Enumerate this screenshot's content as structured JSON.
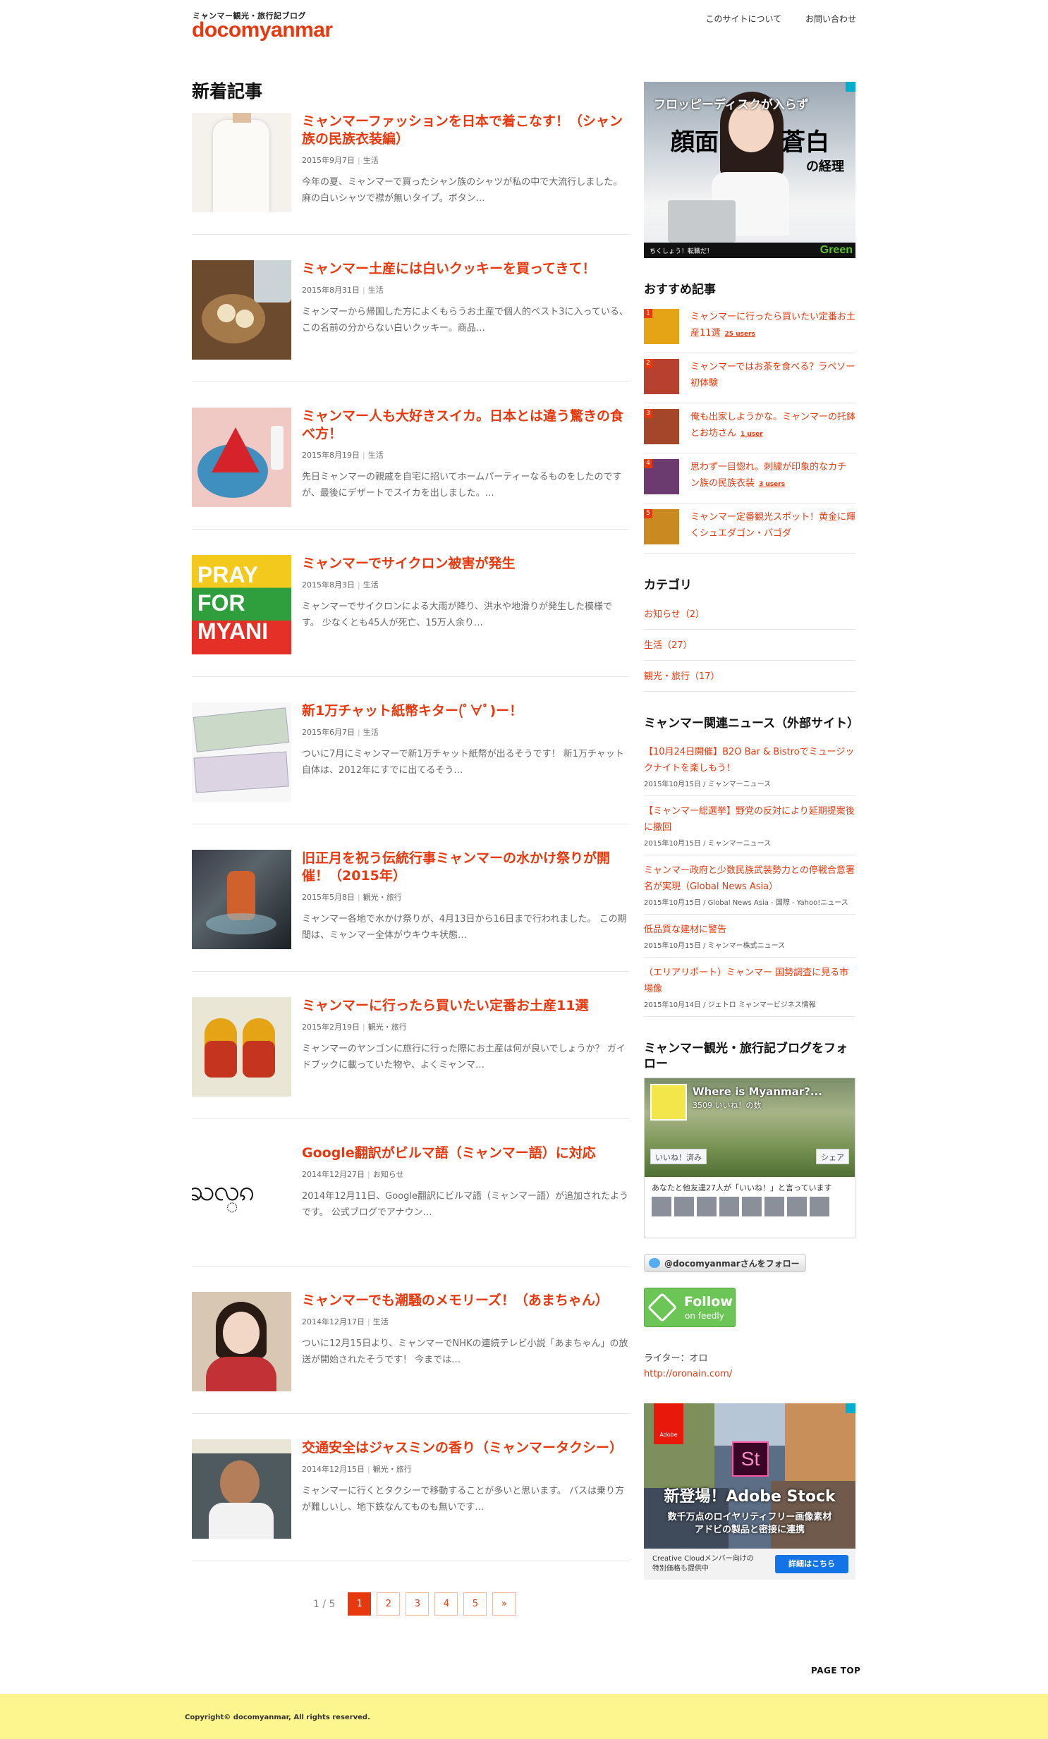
{
  "header": {
    "tagline": "ミャンマー観光・旅行記ブログ",
    "logo": "docomyanmar",
    "nav": [
      "このサイトについて",
      "お問い合わせ"
    ]
  },
  "main": {
    "section_title": "新着記事",
    "entries": [
      {
        "title": "ミャンマーファッションを日本で着こなす！（シャン族の民族衣装編）",
        "date": "2015年9月7日",
        "category": "生活",
        "excerpt": "今年の夏、ミャンマーで買ったシャン族のシャツが私の中で大流行しました。 麻の白いシャツで襟が無いタイプ。ボタン…"
      },
      {
        "title": "ミャンマー土産には白いクッキーを買ってきて！",
        "date": "2015年8月31日",
        "category": "生活",
        "excerpt": "ミャンマーから帰国した方によくもらうお土産で個人的ベスト3に入っている、この名前の分からない白いクッキー。商品…"
      },
      {
        "title": "ミャンマー人も大好きスイカ。日本とは違う驚きの食べ方！",
        "date": "2015年8月19日",
        "category": "生活",
        "excerpt": "先日ミャンマーの親戚を自宅に招いてホームパーティーなるものをしたのですが、最後にデザートでスイカを出しました。…"
      },
      {
        "title": "ミャンマーでサイクロン被害が発生",
        "date": "2015年8月3日",
        "category": "生活",
        "excerpt": "ミャンマーでサイクロンによる大雨が降り、洪水や地滑りが発生した模様です。 少なくとも45人が死亡、15万人余り…"
      },
      {
        "title": "新1万チャット紙幣キター(ﾟ∀ﾟ)ー！",
        "date": "2015年6月7日",
        "category": "生活",
        "excerpt": "ついに7月にミャンマーで新1万チャット紙幣が出るそうです！ 新1万チャット自体は、2012年にすでに出てるそう…"
      },
      {
        "title": "旧正月を祝う伝統行事ミャンマーの水かけ祭りが開催！（2015年）",
        "date": "2015年5月8日",
        "category": "観光・旅行",
        "excerpt": "ミャンマー各地で水かけ祭りが、4月13日から16日まで行われました。 この期間は、ミャンマー全体がウキウキ状態…"
      },
      {
        "title": "ミャンマーに行ったら買いたい定番お土産11選",
        "date": "2015年2月19日",
        "category": "観光・旅行",
        "excerpt": "ミャンマーのヤンゴンに旅行に行った際にお土産は何が良いでしょうか？ ガイドブックに載っていた物や、よくミャンマ…"
      },
      {
        "title": "Google翻訳がビルマ語（ミャンマー語）に対応",
        "date": "2014年12月27日",
        "category": "お知らせ",
        "excerpt": "2014年12月11日、Google翻訳にビルマ語（ミャンマー語）が追加されたようです。 公式ブログでアナウン…"
      },
      {
        "title": "ミャンマーでも潮騒のメモリーズ！（あまちゃん）",
        "date": "2014年12月17日",
        "category": "生活",
        "excerpt": "ついに12月15日より、ミャンマーでNHKの連続テレビ小説「あまちゃん」の放送が開始されたそうです！ 今までは…"
      },
      {
        "title": "交通安全はジャスミンの香り（ミャンマータクシー）",
        "date": "2014年12月15日",
        "category": "観光・旅行",
        "excerpt": "ミャンマーに行くとタクシーで移動することが多いと思います。 バスは乗り方が難しいし、地下鉄なんてものも無いです…"
      }
    ]
  },
  "pagination": {
    "count": "1 / 5",
    "pages": [
      "1",
      "2",
      "3",
      "4",
      "5",
      "»"
    ]
  },
  "sidebar": {
    "ad1": {
      "line1": "フロッピーディスクが入らず",
      "line2": "顔面",
      "line3": "蒼白",
      "line4": "の経理",
      "bottom": "ちくしょう！転職だ！",
      "brand": "Green"
    },
    "recommended_title": "おすすめ記事",
    "recommended": [
      {
        "num": "1",
        "title": "ミャンマーに行ったら買いたい定番お土産11選",
        "users": "25 users"
      },
      {
        "num": "2",
        "title": "ミャンマーではお茶を食べる？ラペソー初体験",
        "users": ""
      },
      {
        "num": "3",
        "title": "俺も出家しようかな。ミャンマーの托鉢とお坊さん",
        "users": "1 user"
      },
      {
        "num": "4",
        "title": "思わず一目惚れ。刺繍が印象的なカチン族の民族衣装",
        "users": "3 users"
      },
      {
        "num": "5",
        "title": "ミャンマー定番観光スポット！黄金に輝くシュエダゴン・パゴダ",
        "users": ""
      }
    ],
    "category_title": "カテゴリ",
    "categories": [
      "お知らせ（2）",
      "生活（27）",
      "観光・旅行（17）"
    ],
    "news_title": "ミャンマー関連ニュース（外部サイト）",
    "news": [
      {
        "title": "【10月24日開催】B2O Bar & Bistroでミュージックナイトを楽しもう！",
        "meta": "2015年10月15日 / ミャンマーニュース"
      },
      {
        "title": "【ミャンマー総選挙】野党の反対により延期提案後に撤回",
        "meta": "2015年10月15日 / ミャンマーニュース"
      },
      {
        "title": "ミャンマー政府と少数民族武装勢力との停戦合意署名が実現（Global News Asia）",
        "meta": "2015年10月15日 / Global News Asia - 国際 - Yahoo!ニュース"
      },
      {
        "title": "低品質な建材に警告",
        "meta": "2015年10月15日 / ミャンマー株式ニュース"
      },
      {
        "title": "（エリアリポート）ミャンマー 国勢調査に見る市場像",
        "meta": "2015年10月14日 / ジェトロ ミャンマービジネス情報"
      }
    ],
    "follow_title": "ミャンマー観光・旅行記ブログをフォロー",
    "fb": {
      "name": "Where is Myanmar?...",
      "likes": "3509 いいね！の数",
      "like_btn": "いいね！済み",
      "share_btn": "シェア",
      "friends": "あなたと他友達27人が「いいね！」と言っています"
    },
    "twitter_label": "@docomyanmarさんをフォロー",
    "feedly": {
      "line1": "Follow",
      "line2": "on feedly"
    },
    "writer_label": "ライター：オロ",
    "writer_link": "http://oronain.com/",
    "ad2": {
      "brand": "Adobe",
      "st": "St",
      "headline": "新登場！Adobe Stock",
      "sub1": "数千万点のロイヤリティフリー画像素材",
      "sub2": "アドビの製品と密接に連携",
      "foot": "Creative Cloudメンバー向けの特別価格も提供中",
      "button": "詳細はこちら"
    }
  },
  "page_top": "PAGE TOP",
  "footer": {
    "copyright": "Copyright© docomyanmar, All rights reserved."
  }
}
